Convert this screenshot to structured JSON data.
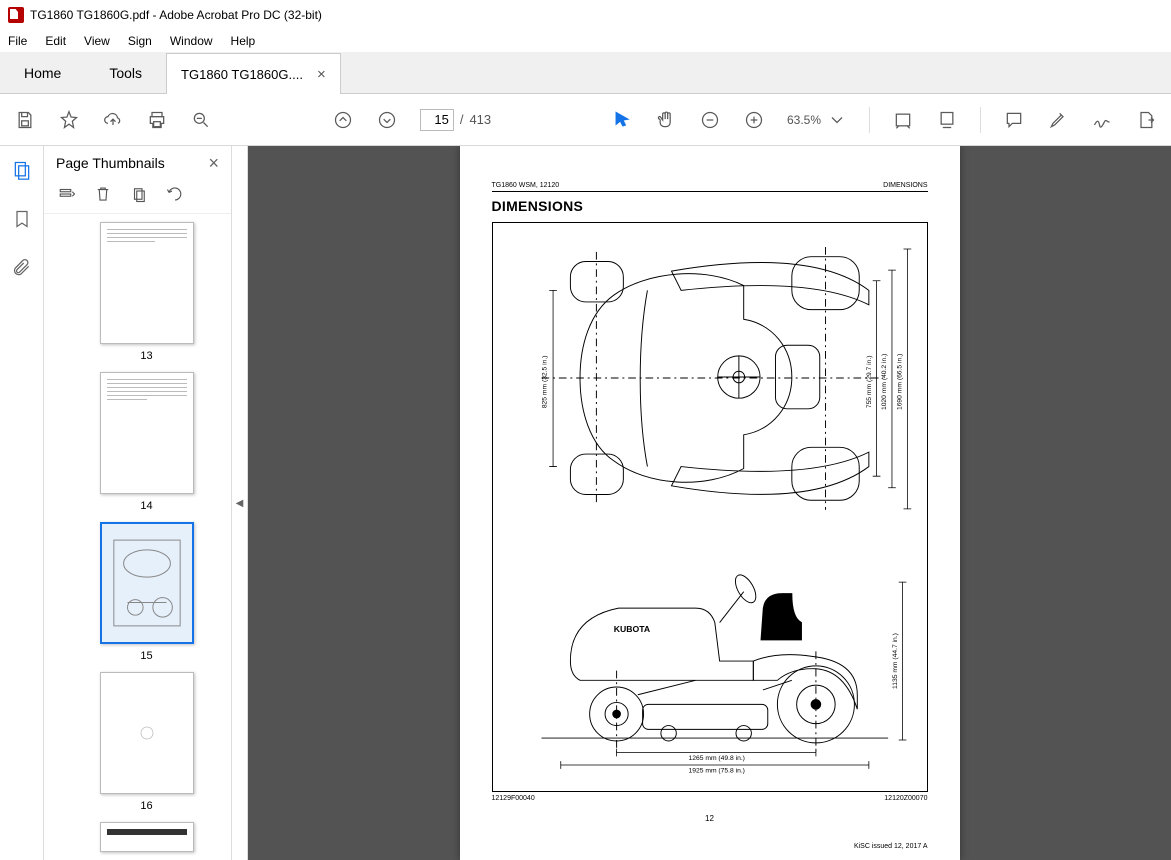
{
  "titlebar": {
    "text": "TG1860 TG1860G.pdf - Adobe Acrobat Pro DC (32-bit)"
  },
  "menubar": {
    "items": [
      "File",
      "Edit",
      "View",
      "Sign",
      "Window",
      "Help"
    ]
  },
  "maintabs": {
    "home": "Home",
    "tools": "Tools",
    "doc": "TG1860 TG1860G...."
  },
  "toolbar": {
    "page_current": "15",
    "page_sep": "/",
    "page_total": "413",
    "zoom": "63.5%"
  },
  "thumbnails": {
    "title": "Page Thumbnails",
    "pages": [
      "13",
      "14",
      "15",
      "16"
    ],
    "selected": "15"
  },
  "document": {
    "header_left": "TG1860 WSM, 12120",
    "header_right": "DIMENSIONS",
    "heading": "DIMENSIONS",
    "brand": "KUBOTA",
    "dims": {
      "dim_825": "825 mm (32.5 in.)",
      "dim_755": "755 mm (29.7 in.)",
      "dim_1020": "1020 mm (40.2 in.)",
      "dim_1690": "1690 mm (66.5 in.)",
      "dim_1135": "1135 mm (44.7 in.)",
      "dim_1265": "1265 mm (49.8 in.)",
      "dim_1925": "1925 mm (75.8 in.)"
    },
    "footer_left": "12129F00040",
    "footer_right": "12120Z00070",
    "page_number": "12",
    "issuance": "KiSC issued 12, 2017 A"
  }
}
